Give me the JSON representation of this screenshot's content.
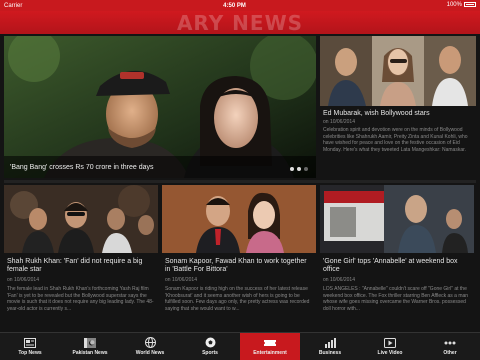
{
  "status_bar": {
    "carrier": "Carrier",
    "time": "4:50 PM",
    "battery": "100%"
  },
  "colors": {
    "brand": "#c8191e",
    "background": "#141414"
  },
  "featured": {
    "caption": "'Bang Bang' crosses Rs 70 crore in three days",
    "pager": {
      "total": 3,
      "current": 1
    }
  },
  "side_story": {
    "title": "Ed Mubarak, wish Bollywood stars",
    "date": "on 10/06/2014",
    "body": "Celebration spirit and devotion were on the minds of Bollywood celebrities like Shahrukh Aamir, Preity Zinta and Kunal Kohli, who have wished for peace and love on the festive occasion of Eid Monday. Here's what they tweeted Lata Mangeshkar: Namaskar. Aap sab ko Eid..."
  },
  "stories": [
    {
      "title": "Shah Rukh Khan: 'Fan' did not require a big female star",
      "date": "on 10/06/2014",
      "body": "The female lead in Shah Rukh Khan's forthcoming Yash Raj film 'Fan' is yet to be revealed but the Bollywood superstar says the movie is such that it does not require any big leading lady. The 48-year-old actor is currently s..."
    },
    {
      "title": "Sonam Kapoor, Fawad Khan to work together in 'Battle For Bittora'",
      "date": "on 10/06/2014",
      "body": "Sonam Kapoor is riding high on the success of her latest release 'Khoobsurat' and it seems another wish of hers is going to be fulfilled soon. Few days ago only, the pretty actress was recorded saying that she would want to w..."
    },
    {
      "title": "'Gone Girl' tops 'Annabelle' at weekend box office",
      "date": "on 10/06/2014",
      "body": "LOS ANGELES : \"Annabelle\" couldn't scare off \"Gone Girl\" at the weekend box office. The Fox thriller starring Ben Affleck as a man whose wife goes missing overcame the Warner Bros. possessed doll horror with..."
    }
  ],
  "tabs": [
    {
      "label": "Top News",
      "icon": "newspaper-icon"
    },
    {
      "label": "Pakistan News",
      "icon": "pakistan-flag-icon"
    },
    {
      "label": "World News",
      "icon": "globe-icon"
    },
    {
      "label": "Sports",
      "icon": "soccer-ball-icon"
    },
    {
      "label": "Entertainment",
      "icon": "ticket-icon",
      "active": true
    },
    {
      "label": "Business",
      "icon": "chart-icon"
    },
    {
      "label": "Live Video",
      "icon": "video-icon"
    },
    {
      "label": "Other",
      "icon": "more-icon"
    }
  ]
}
